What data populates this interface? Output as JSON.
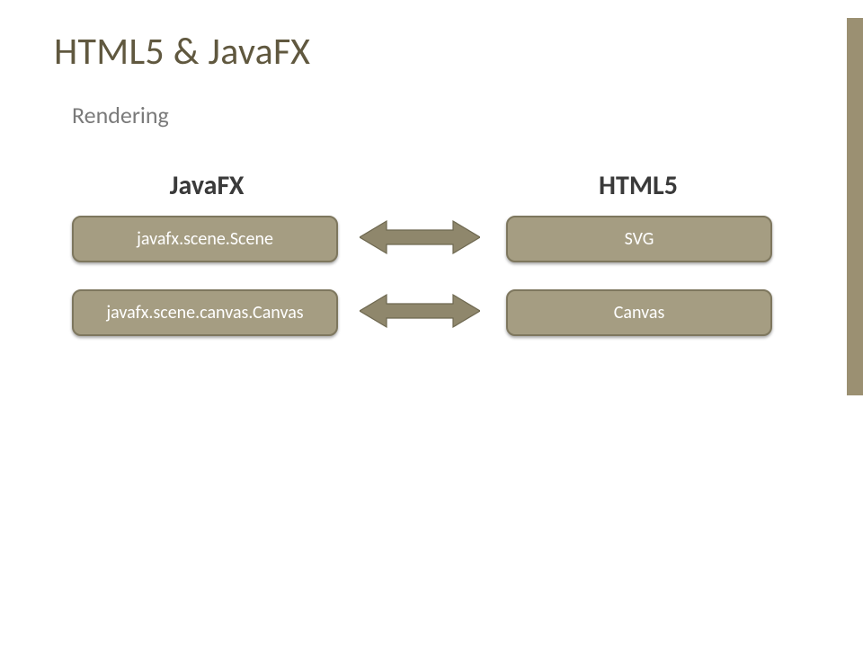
{
  "title": "HTML5 & JavaFX",
  "subtitle": "Rendering",
  "columns": {
    "left": "JavaFX",
    "right": "HTML5"
  },
  "rows": [
    {
      "left": "javafx.scene.Scene",
      "right": "SVG"
    },
    {
      "left": "javafx.scene.canvas.Canvas",
      "right": "Canvas"
    }
  ],
  "colors": {
    "box_fill": "#a59d82",
    "box_border": "#7e775e",
    "arrow_fill": "#8f876c",
    "accent": "#9b9072",
    "title": "#60583f"
  }
}
